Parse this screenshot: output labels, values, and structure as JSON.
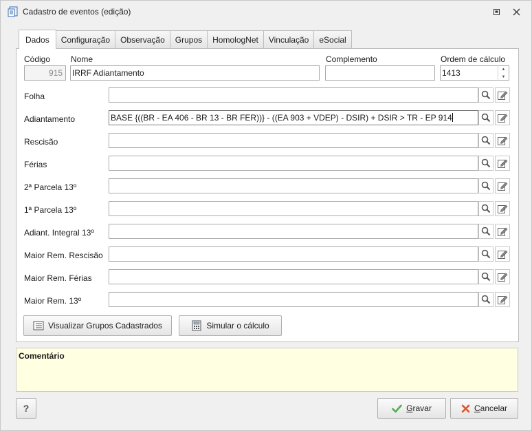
{
  "window": {
    "title": "Cadastro de eventos (edição)"
  },
  "tabs": [
    "Dados",
    "Configuração",
    "Observação",
    "Grupos",
    "HomologNet",
    "Vinculação",
    "eSocial"
  ],
  "header": {
    "codigo_label": "Código",
    "codigo_value": "915",
    "nome_label": "Nome",
    "nome_value": "IRRF Adiantamento",
    "complemento_label": "Complemento",
    "complemento_value": "",
    "ordem_label": "Ordem de cálculo",
    "ordem_value": "1413"
  },
  "formulas": [
    {
      "label": "Folha",
      "value": ""
    },
    {
      "label": "Adiantamento",
      "value": "BASE {((BR - EA 406 - BR 13 - BR FER))} - ((EA 903 + VDEP) - DSIR) + DSIR > TR - EP 914"
    },
    {
      "label": "Rescisão",
      "value": ""
    },
    {
      "label": "Férias",
      "value": ""
    },
    {
      "label": "2ª Parcela 13º",
      "value": ""
    },
    {
      "label": "1ª Parcela 13º",
      "value": ""
    },
    {
      "label": "Adiant. Integral 13º",
      "value": ""
    },
    {
      "label": "Maior Rem. Rescisão",
      "value": ""
    },
    {
      "label": "Maior Rem. Férias",
      "value": ""
    },
    {
      "label": "Maior Rem. 13º",
      "value": ""
    }
  ],
  "buttons": {
    "visualizar": "Visualizar Grupos Cadastrados",
    "simular": "Simular o cálculo",
    "help": "?",
    "gravar_first": "G",
    "gravar_rest": "ravar",
    "cancelar_first": "C",
    "cancelar_rest": "ancelar"
  },
  "comment": {
    "title": "Comentário",
    "text": ""
  },
  "icons": {
    "search": "search-icon",
    "edit": "edit-icon",
    "ok": "check-icon",
    "cancel": "x-icon",
    "accent_green": "#4caf50",
    "accent_red": "#e0522c"
  }
}
